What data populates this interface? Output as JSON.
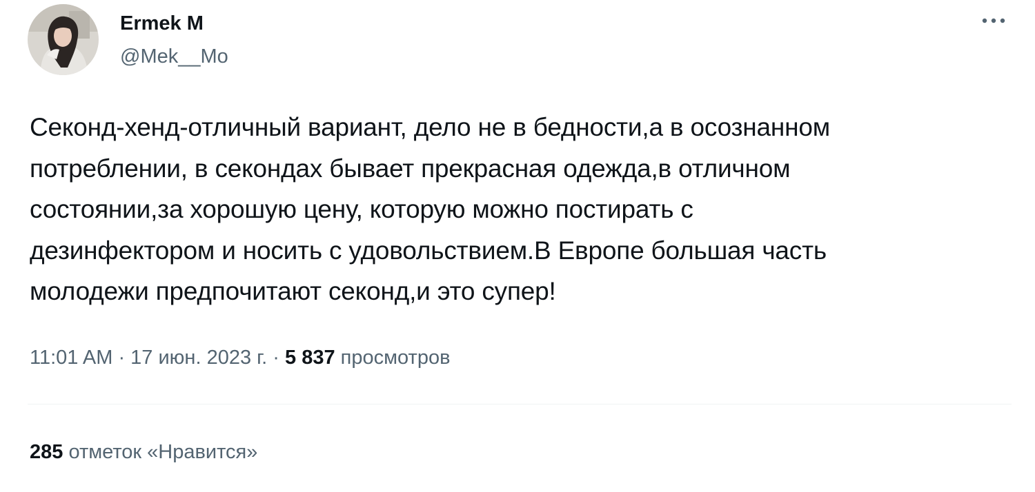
{
  "author": {
    "display_name": "Ermek M",
    "handle": "@Mek__Mo",
    "avatar_icon": "profile-photo"
  },
  "menu": {
    "more_icon": "more-horizontal-icon"
  },
  "tweet": {
    "text_lines": [
      "Секонд-хенд-отличный вариант, дело не в бедности,а в осознанном",
      "потреблении, в секондах бывает прекрасная одежда,в отличном",
      "состоянии,за хорошую цену, которую можно постирать с",
      "дезинфектором и носить с удовольствием.В Европе большая часть",
      "молодежи предпочитают секонд,и это супер!"
    ]
  },
  "meta": {
    "time": "11:01 AM",
    "separator": " · ",
    "date": "17 июн. 2023 г.",
    "views_count": "5 837",
    "views_label": "просмотров"
  },
  "engagement": {
    "likes_count": "285",
    "likes_label": "отметок «Нравится»"
  },
  "colors": {
    "text_primary": "#0f1419",
    "text_secondary": "#536471",
    "divider": "#eff3f4"
  }
}
